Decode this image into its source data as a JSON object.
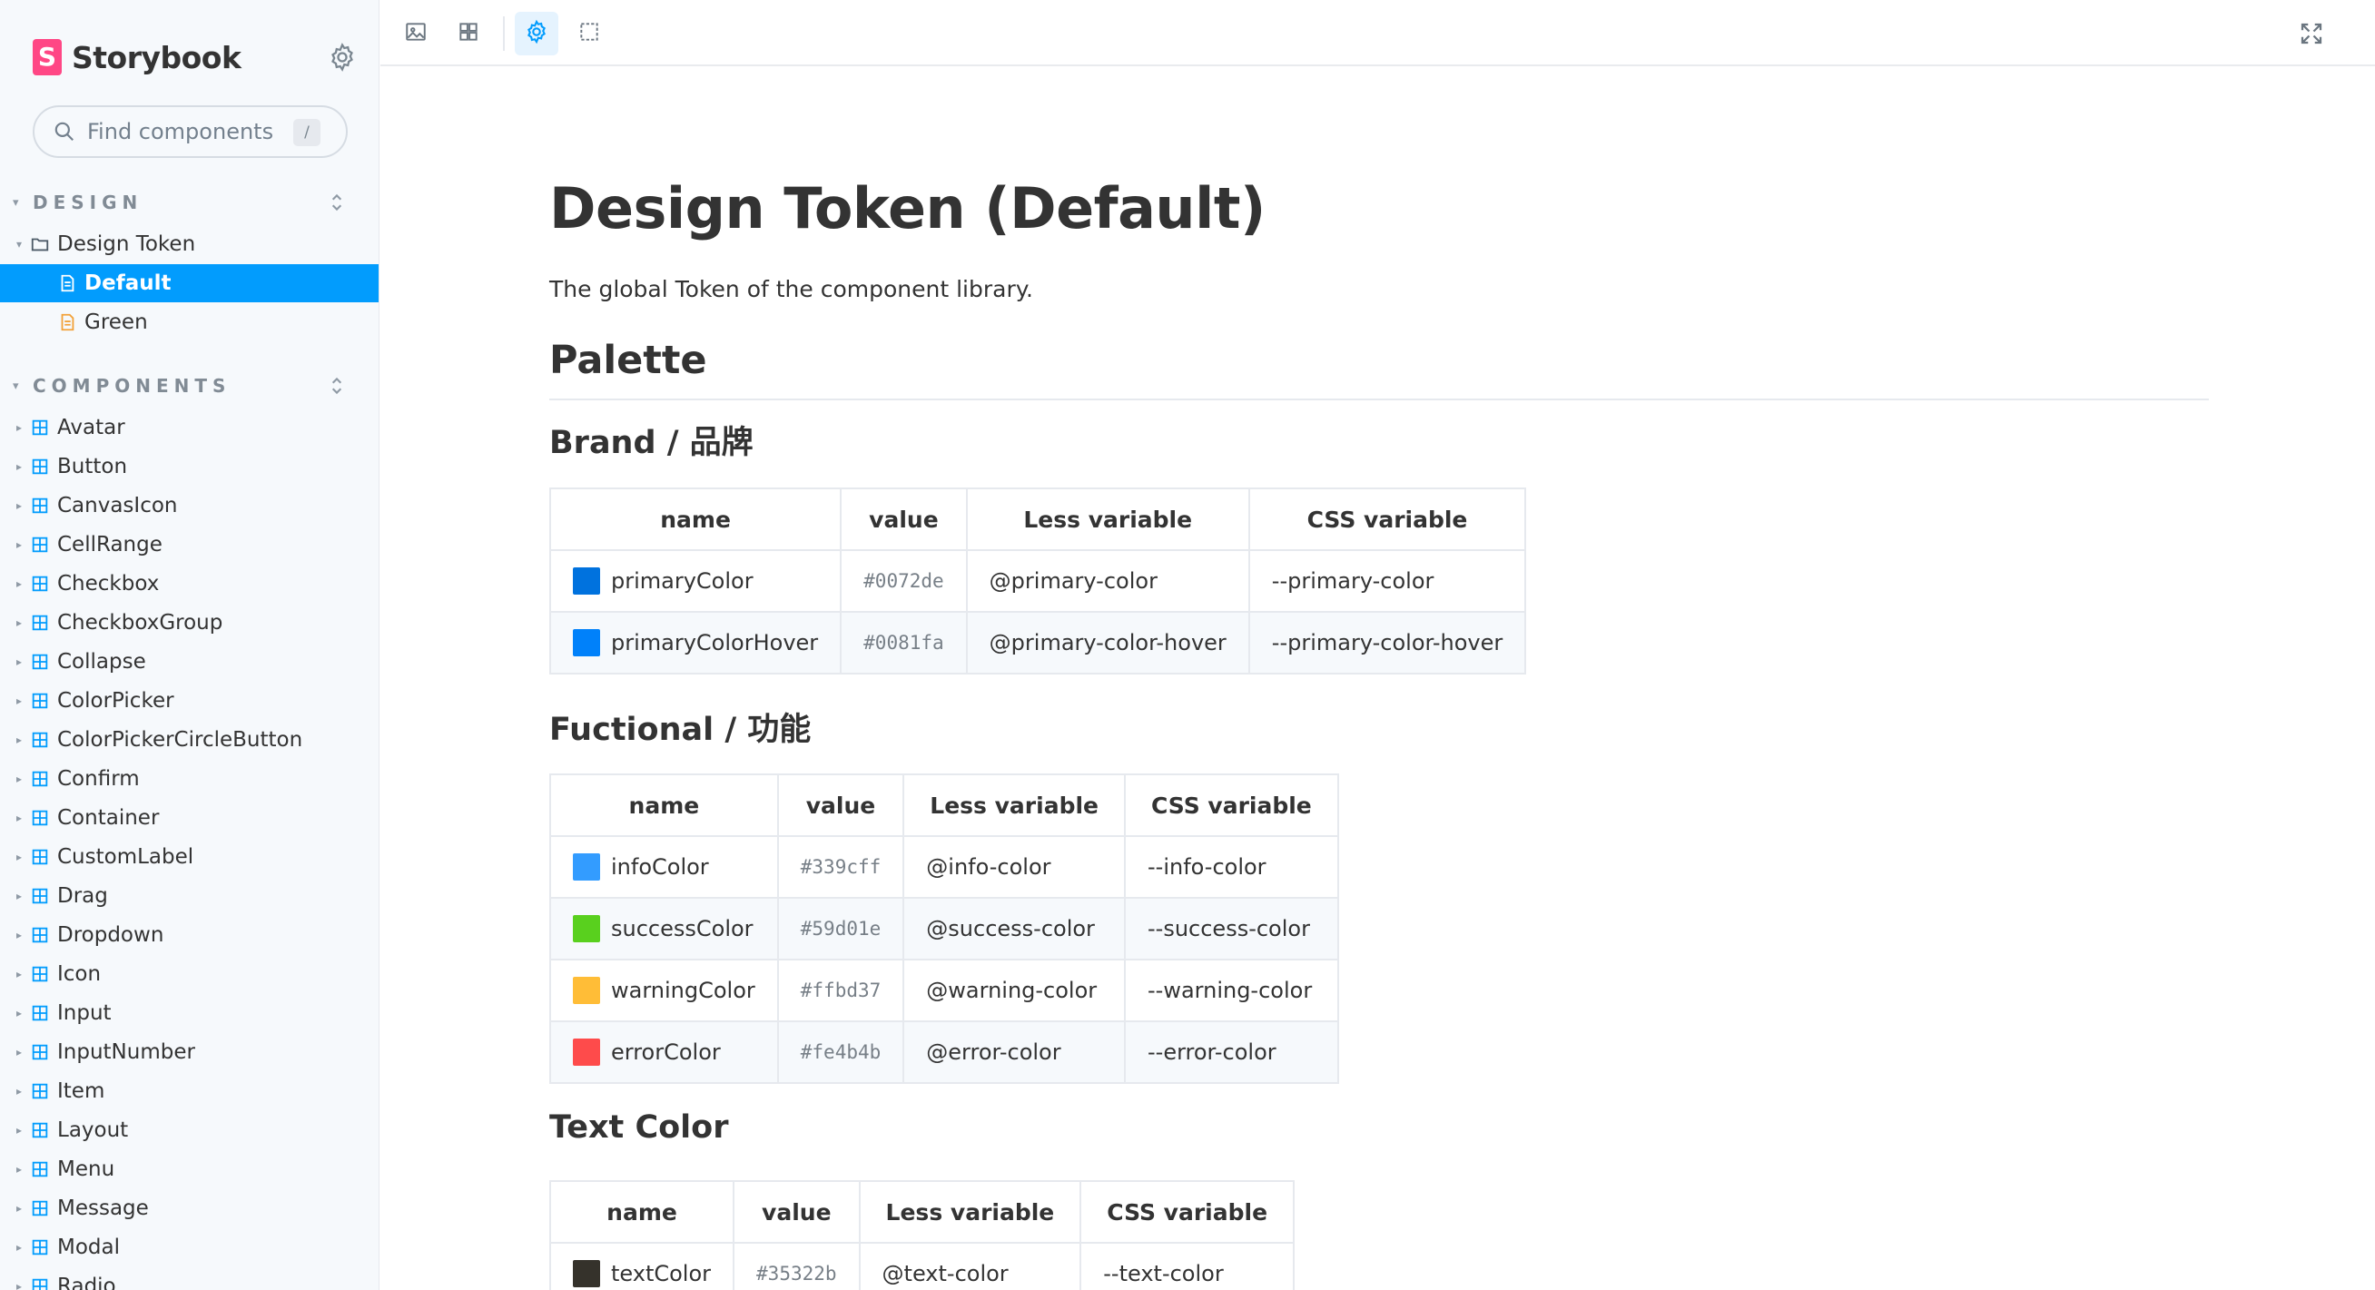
{
  "app": {
    "title": "Storybook",
    "logo_letter": "S"
  },
  "search": {
    "placeholder": "Find components",
    "shortcut": "/"
  },
  "sidebar": {
    "design_section": {
      "label": "DESIGN",
      "group": "Design Token",
      "stories": [
        {
          "label": "Default",
          "active": true
        },
        {
          "label": "Green",
          "active": false
        }
      ]
    },
    "components_section": {
      "label": "COMPONENTS",
      "items": [
        "Avatar",
        "Button",
        "CanvasIcon",
        "CellRange",
        "Checkbox",
        "CheckboxGroup",
        "Collapse",
        "ColorPicker",
        "ColorPickerCircleButton",
        "Confirm",
        "Container",
        "CustomLabel",
        "Drag",
        "Dropdown",
        "Icon",
        "Input",
        "InputNumber",
        "Item",
        "Layout",
        "Menu",
        "Message",
        "Modal",
        "Radio"
      ]
    }
  },
  "toolbar": {
    "buttons": [
      {
        "icon": "image-icon",
        "active": false
      },
      {
        "icon": "grid-icon",
        "active": false
      },
      {
        "icon": "gear-icon",
        "active": true
      },
      {
        "icon": "frame-icon",
        "active": false
      }
    ],
    "fullscreen_icon": "fullscreen-icon"
  },
  "doc": {
    "title": "Design Token (Default)",
    "description": "The global Token of the component library.",
    "palette_heading": "Palette",
    "columns": [
      "name",
      "value",
      "Less variable",
      "CSS variable"
    ],
    "brand": {
      "heading": "Brand / 品牌",
      "rows": [
        {
          "name": "primaryColor",
          "value": "#0072de",
          "less": "@primary-color",
          "css": "--primary-color",
          "swatch": "#0072de"
        },
        {
          "name": "primaryColorHover",
          "value": "#0081fa",
          "less": "@primary-color-hover",
          "css": "--primary-color-hover",
          "swatch": "#0081fa"
        }
      ]
    },
    "functional": {
      "heading": "Fuctional / 功能",
      "rows": [
        {
          "name": "infoColor",
          "value": "#339cff",
          "less": "@info-color",
          "css": "--info-color",
          "swatch": "#339cff"
        },
        {
          "name": "successColor",
          "value": "#59d01e",
          "less": "@success-color",
          "css": "--success-color",
          "swatch": "#59d01e"
        },
        {
          "name": "warningColor",
          "value": "#ffbd37",
          "less": "@warning-color",
          "css": "--warning-color",
          "swatch": "#ffbd37"
        },
        {
          "name": "errorColor",
          "value": "#fe4b4b",
          "less": "@error-color",
          "css": "--error-color",
          "swatch": "#fe4b4b"
        }
      ]
    },
    "text_color": {
      "heading": "Text Color",
      "rows": [
        {
          "name": "textColor",
          "value": "#35322b",
          "less": "@text-color",
          "css": "--text-color",
          "swatch": "#35322b"
        }
      ]
    }
  },
  "colors": {
    "accent": "#029cfd",
    "brand": "#ff4785",
    "sidebar_bg": "#f6f9fc",
    "border": "#e6e9ee"
  }
}
